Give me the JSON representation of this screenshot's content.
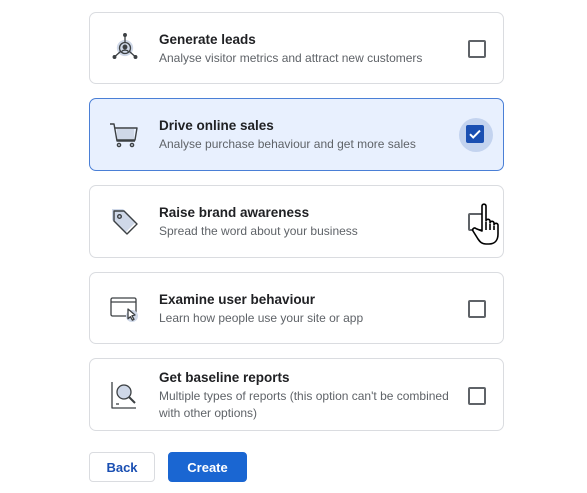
{
  "options": [
    {
      "icon": "target-network-icon",
      "title": "Generate leads",
      "description": "Analyse visitor metrics and attract new customers",
      "checked": false
    },
    {
      "icon": "shopping-cart-icon",
      "title": "Drive online sales",
      "description": "Analyse purchase behaviour and get more sales",
      "checked": true
    },
    {
      "icon": "price-tag-icon",
      "title": "Raise brand awareness",
      "description": "Spread the word about your business",
      "checked": false
    },
    {
      "icon": "browser-cursor-icon",
      "title": "Examine user behaviour",
      "description": "Learn how people use your site or app",
      "checked": false
    },
    {
      "icon": "report-magnifier-icon",
      "title": "Get baseline reports",
      "description": "Multiple types of reports (this option can't be combined with other options)",
      "checked": false
    }
  ],
  "buttons": {
    "back_label": "Back",
    "create_label": "Create"
  },
  "colors": {
    "selected_background": "#e8f0fe",
    "selected_border": "#4a7fd6",
    "checkbox_checked": "#1a4fb2",
    "primary_button": "#1a66d2"
  }
}
